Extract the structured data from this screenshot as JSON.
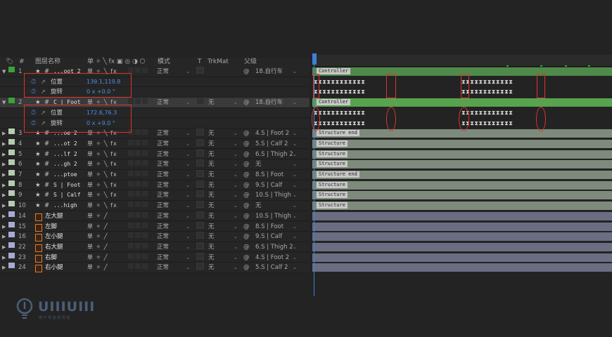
{
  "header": {
    "num": "#",
    "layer_name": "图层名称",
    "switches": "单 ✧ ╲ fx ▣ ◎ ◑ ⬡",
    "mode": "模式",
    "t": "T",
    "trkmat": "TrkMat",
    "parent": "父级"
  },
  "layers": [
    {
      "index": "1",
      "name": "...oot 2",
      "color": "#3aa23a",
      "mode": "正常",
      "trkmat": "",
      "parent": "18.自行车",
      "bar": "Controller",
      "bar_color": "#4f8a4a",
      "selected": false,
      "kind": "shape",
      "expanded": true
    },
    {
      "index": "2",
      "name": "C | Foot",
      "color": "#3aa23a",
      "mode": "正常",
      "trkmat": "无",
      "parent": "18.自行车",
      "bar": "Controller",
      "bar_color": "#57a34e",
      "selected": true,
      "kind": "shape",
      "expanded": true
    },
    {
      "index": "3",
      "name": "...oe 2",
      "color": "#b5ccb0",
      "mode": "正常",
      "trkmat": "无",
      "parent": "4.S | Foot 2",
      "bar": "Structure end",
      "bar_color": "#7e8a7c",
      "kind": "shape"
    },
    {
      "index": "4",
      "name": "...ot 2",
      "color": "#b5ccb0",
      "mode": "正常",
      "trkmat": "无",
      "parent": "5.S | Calf 2",
      "bar": "Structure",
      "bar_color": "#7e8a7c",
      "kind": "shape"
    },
    {
      "index": "5",
      "name": "...lf 2",
      "color": "#b5ccb0",
      "mode": "正常",
      "trkmat": "无",
      "parent": "6.S | Thigh 2",
      "bar": "Structure",
      "bar_color": "#7e8a7c",
      "kind": "shape"
    },
    {
      "index": "6",
      "name": "...gh 2",
      "color": "#b5ccb0",
      "mode": "正常",
      "trkmat": "无",
      "parent": "无",
      "bar": "Structure",
      "bar_color": "#7e8a7c",
      "kind": "shape"
    },
    {
      "index": "7",
      "name": "...ptoe",
      "color": "#b5ccb0",
      "mode": "正常",
      "trkmat": "无",
      "parent": "8.S | Foot",
      "bar": "Structure end",
      "bar_color": "#7e8a7c",
      "kind": "shape"
    },
    {
      "index": "8",
      "name": "S | Foot",
      "color": "#b5ccb0",
      "mode": "正常",
      "trkmat": "无",
      "parent": "9.S | Calf",
      "bar": "Structure",
      "bar_color": "#7e8a7c",
      "kind": "shape"
    },
    {
      "index": "9",
      "name": "S | Calf",
      "color": "#b5ccb0",
      "mode": "正常",
      "trkmat": "无",
      "parent": "10.S | Thigh",
      "bar": "Structure",
      "bar_color": "#7e8a7c",
      "kind": "shape"
    },
    {
      "index": "10",
      "name": "...high",
      "color": "#b5ccb0",
      "mode": "正常",
      "trkmat": "无",
      "parent": "无",
      "bar": "Structure",
      "bar_color": "#7e8a7c",
      "kind": "shape"
    },
    {
      "index": "14",
      "name": "左大腿",
      "color": "#a9a9d6",
      "mode": "正常",
      "trkmat": "无",
      "parent": "10.S | Thigh",
      "bar": "",
      "bar_color": "#6b6e82",
      "kind": "comp"
    },
    {
      "index": "15",
      "name": "左脚",
      "color": "#a9a9d6",
      "mode": "正常",
      "trkmat": "无",
      "parent": "8.S | Foot",
      "bar": "",
      "bar_color": "#6b6e82",
      "kind": "comp"
    },
    {
      "index": "16",
      "name": "左小腿",
      "color": "#a9a9d6",
      "mode": "正常",
      "trkmat": "无",
      "parent": "9.S | Calf",
      "bar": "",
      "bar_color": "#6b6e82",
      "kind": "comp"
    },
    {
      "index": "22",
      "name": "右大腿",
      "color": "#a9a9d6",
      "mode": "正常",
      "trkmat": "无",
      "parent": "6.S | Thigh 2",
      "bar": "",
      "bar_color": "#6b6e82",
      "kind": "comp"
    },
    {
      "index": "23",
      "name": "右脚",
      "color": "#a9a9d6",
      "mode": "正常",
      "trkmat": "无",
      "parent": "4.S | Foot 2",
      "bar": "",
      "bar_color": "#6b6e82",
      "kind": "comp"
    },
    {
      "index": "24",
      "name": "右小腿",
      "color": "#a9a9d6",
      "mode": "正常",
      "trkmat": "无",
      "parent": "5.S | Calf 2",
      "bar": "",
      "bar_color": "#6b6e82",
      "kind": "comp"
    }
  ],
  "props": {
    "l1_pos_label": "位置",
    "l1_pos_value": "139.1,119.8",
    "l1_rot_label": "旋转",
    "l1_rot_value": "0 x +0.0 °",
    "l2_pos_label": "位置",
    "l2_pos_value": "172.6,76.3",
    "l2_rot_label": "旋转",
    "l2_rot_value": "0 x +9.0 °"
  },
  "keyframes": {
    "group_a": "⧗⧗⧗⧗⧗⧗⧗⧗⧗⧗⧗⧗",
    "group_b": "⧗⧗⧗⧗⧗⧗⧗⧗⧗⧗⧗⧗"
  },
  "logo": {
    "text": "UIIIUIII",
    "sub": "用 户 体 验 研 究 站"
  },
  "colors": {
    "highlight": "#e0342b",
    "playhead": "#3d7fd6"
  }
}
